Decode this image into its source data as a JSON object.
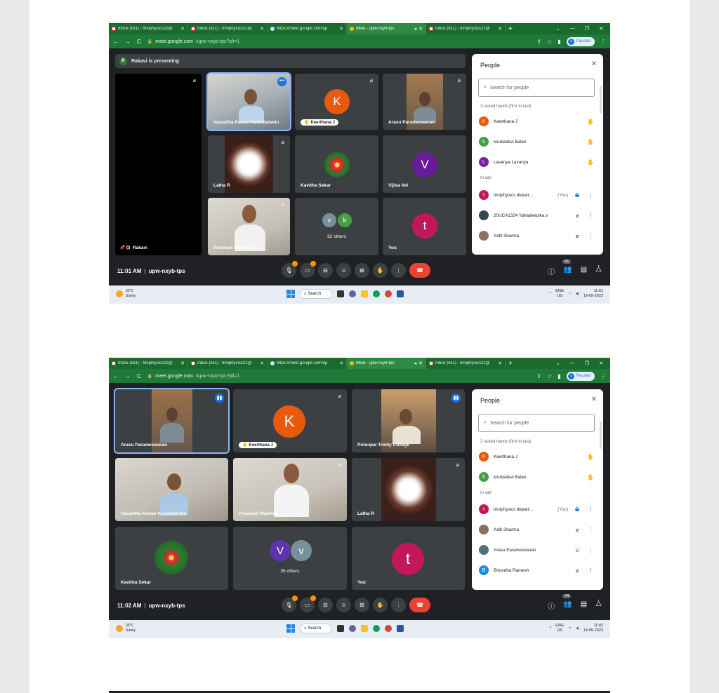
{
  "screens": [
    {
      "tabs": [
        {
          "label": "Inbox (611) - triniphysics22@",
          "kind": "gm"
        },
        {
          "label": "Inbox (611) - triniphysics22@",
          "kind": "gm"
        },
        {
          "label": "https://meet.google.com/up",
          "kind": "gl"
        },
        {
          "label": "Meet - upw-nxyb-tps",
          "kind": "mt",
          "active": true
        },
        {
          "label": "Inbox (611) - triniphysics22@",
          "kind": "gm"
        }
      ],
      "url": {
        "host": "meet.google.com",
        "path": "/upw-nxyb-tps?pli=1"
      },
      "profile_status": "Paused",
      "banner": {
        "avatar": "R",
        "text": "Rakavi is presenting"
      },
      "tiles": [
        {
          "name": "Rakavi"
        },
        {
          "name": "Vasantha Kumar Kulandaivelu"
        },
        {
          "name": "Keerthana J",
          "avatar": "K"
        },
        {
          "name": "Arasu Parameswaran"
        },
        {
          "name": "Latha R"
        },
        {
          "name": "Kavitha Sekar"
        },
        {
          "name": "Vijisa Vel",
          "avatar": "V"
        },
        {
          "name": "Prashant Wadhwa"
        },
        {
          "name": "32 others",
          "avatars": [
            "v",
            "k"
          ]
        },
        {
          "name": "You",
          "avatar": "t"
        }
      ],
      "people": {
        "title": "People",
        "search_placeholder": "Search for people",
        "raised_header": "3 raised hands (first to last)",
        "raised": [
          {
            "name": "Keerthana J",
            "avatar": "K",
            "color": "#e8590c"
          },
          {
            "name": "kirubadevi Balan",
            "avatar": "k",
            "color": "#43a047"
          },
          {
            "name": "Lavanya Lavanya",
            "avatar": "L",
            "color": "#7b1fa2"
          }
        ],
        "incall_header": "In call",
        "incall": [
          {
            "name": "triniphysics depart...",
            "you": "(You)",
            "avatar": "t",
            "color": "#c2185b",
            "status": "more"
          },
          {
            "name": "20UCA1324 Yahadeepika.s",
            "avatar": "",
            "color": "#37474f",
            "status": "muted"
          },
          {
            "name": "Aditi Sharma",
            "avatar": "",
            "color": "#8d6e63",
            "status": "muted"
          }
        ]
      },
      "time": "11:01 AM",
      "meeting_code": "upw-nxyb-tps",
      "participant_count": "41",
      "taskbar": {
        "temp": "33°C",
        "weather": "Sunny",
        "search": "Search",
        "lang": "ENG",
        "region": "US",
        "clock": "11:01",
        "date": "19-05-2023"
      }
    },
    {
      "tabs": [
        {
          "label": "Inbox (611) - triniphysics22@",
          "kind": "gm"
        },
        {
          "label": "Inbox (611) - triniphysics22@",
          "kind": "gm"
        },
        {
          "label": "https://meet.google.com/up",
          "kind": "gl"
        },
        {
          "label": "Meet - upw-nxyb-tps",
          "kind": "mt",
          "active": true
        },
        {
          "label": "Inbox (611) - triniphysics22@",
          "kind": "gm"
        }
      ],
      "url": {
        "host": "meet.google.com",
        "path": "/upw-nxyb-tps?pli=1"
      },
      "profile_status": "Paused",
      "tiles": [
        {
          "name": "Arasu Parameswaran"
        },
        {
          "name": "Keerthana J",
          "avatar": "K"
        },
        {
          "name": "Principal Trinity College"
        },
        {
          "name": "Vasantha Kumar Kulandaivelu"
        },
        {
          "name": "Prashant Wadhwa"
        },
        {
          "name": "Latha R"
        },
        {
          "name": "Kavitha Sekar"
        },
        {
          "name": "35 others",
          "avatars": [
            "V",
            "v"
          ]
        },
        {
          "name": "You",
          "avatar": "t"
        }
      ],
      "people": {
        "title": "People",
        "search_placeholder": "Search for people",
        "raised_header": "2 raised hands (first to last)",
        "raised": [
          {
            "name": "Keerthana J",
            "avatar": "K",
            "color": "#e8590c"
          },
          {
            "name": "kirubadevi Balan",
            "avatar": "k",
            "color": "#43a047"
          }
        ],
        "incall_header": "In call",
        "incall": [
          {
            "name": "triniphysics depart...",
            "you": "(You)",
            "avatar": "t",
            "color": "#c2185b",
            "status": "more"
          },
          {
            "name": "Aditi Sharma",
            "avatar": "",
            "color": "#8d6e63",
            "status": "muted"
          },
          {
            "name": "Arasu Parameswaran",
            "avatar": "",
            "color": "#546e7a",
            "status": "speaking"
          },
          {
            "name": "Birundha Ramesh",
            "avatar": "B",
            "color": "#1e88e5",
            "status": "muted"
          }
        ]
      },
      "time": "11:02 AM",
      "meeting_code": "upw-nxyb-tps",
      "participant_count": "44",
      "taskbar": {
        "temp": "33°C",
        "weather": "Sunny",
        "search": "Search",
        "lang": "ENG",
        "region": "US",
        "clock": "11:02",
        "date": "19-05-2023"
      }
    }
  ],
  "icons": {
    "mic_muted": "mic-off-icon",
    "raised_hand": "hand-icon",
    "more": "more-vert-icon",
    "close": "close-icon",
    "search": "search-icon"
  },
  "colors": {
    "meet_bg": "#202124",
    "tile_bg": "#3c4043",
    "chrome_green": "#1e7a36",
    "end_call": "#ea4335",
    "accent": "#1a73e8"
  }
}
